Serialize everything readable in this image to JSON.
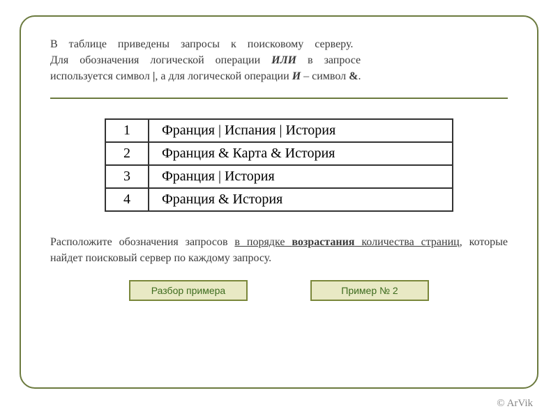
{
  "intro": {
    "line1_a": "В",
    "line1_b": "таблице",
    "line1_c": "приведены",
    "line1_d": "запросы",
    "line1_e": "к",
    "line1_f": "поисковому",
    "line1_g": "серверу.",
    "line2_a": "Для",
    "line2_b": "обозначения",
    "line2_c": "логической",
    "line2_d": "операции",
    "line2_or": "ИЛИ",
    "line2_e": "в",
    "line2_f": "запросе",
    "line3_a": "используется символ ",
    "line3_pipe": "|",
    "line3_b": ", а для логической операции ",
    "line3_and": "И",
    "line3_c": " – символ ",
    "line3_amp": "&",
    "line3_d": "."
  },
  "rows": [
    {
      "num": "1",
      "query": "Франция  |  Испания  |  История"
    },
    {
      "num": "2",
      "query": "Франция  &  Карта  &  История"
    },
    {
      "num": "3",
      "query": "Франция  |  История"
    },
    {
      "num": "4",
      "query": "Франция  &  История"
    }
  ],
  "task": {
    "a": "Расположите  обозначения  запросов  ",
    "b_u": "в  порядке  ",
    "c_ub": "возрастания",
    "d_u": " количества  страниц",
    "e": ",  которые  найдет  поисковый  сервер  по  каждому запросу."
  },
  "buttons": {
    "left": "Разбор примера",
    "right": "Пример № 2"
  },
  "copyright": "© ArVik"
}
